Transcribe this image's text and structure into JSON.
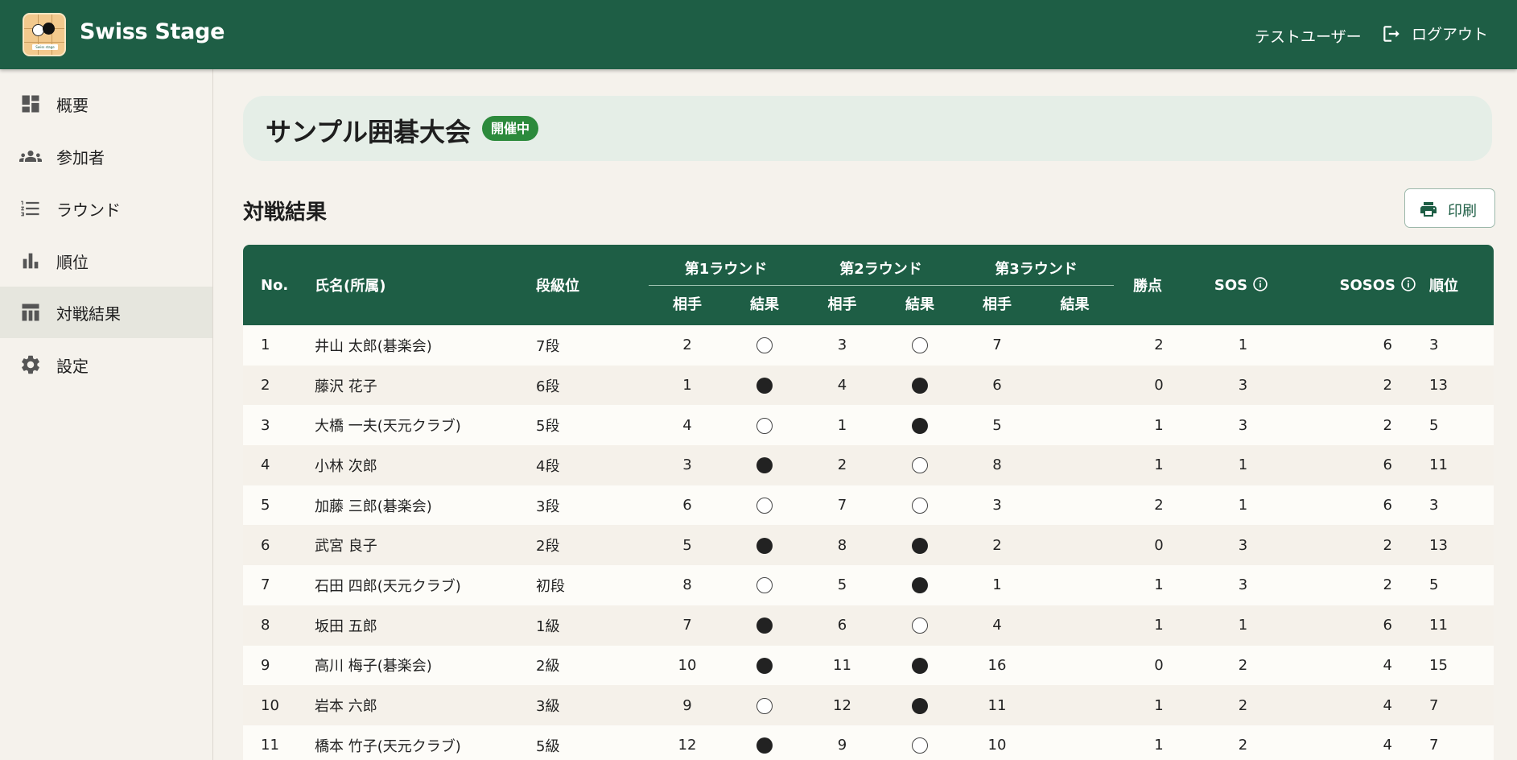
{
  "app": {
    "title": "Swiss Stage",
    "logo_text": "Swiss stage"
  },
  "header": {
    "user_name": "テストユーザー",
    "logout_label": "ログアウト"
  },
  "sidebar": {
    "items": [
      {
        "label": "概要",
        "icon": "dashboard-icon",
        "active": false
      },
      {
        "label": "参加者",
        "icon": "people-icon",
        "active": false
      },
      {
        "label": "ラウンド",
        "icon": "numbered-list-icon",
        "active": false
      },
      {
        "label": "順位",
        "icon": "bar-chart-icon",
        "active": false
      },
      {
        "label": "対戦結果",
        "icon": "table-icon",
        "active": true
      },
      {
        "label": "設定",
        "icon": "gear-icon",
        "active": false
      }
    ]
  },
  "tournament": {
    "name": "サンプル囲碁大会",
    "status": "開催中"
  },
  "section": {
    "title": "対戦結果",
    "print_label": "印刷"
  },
  "table": {
    "headers": {
      "no": "No.",
      "name": "氏名(所属)",
      "rank": "段級位",
      "rounds": [
        "第1ラウンド",
        "第2ラウンド",
        "第3ラウンド"
      ],
      "opponent": "相手",
      "result": "結果",
      "wins": "勝点",
      "sos": "SOS",
      "sosos": "SOSOS",
      "place": "順位"
    },
    "rows": [
      {
        "no": "1",
        "name": "井山 太郎(碁楽会)",
        "rank": "7段",
        "r1_opp": "2",
        "r1_res": "win",
        "r2_opp": "3",
        "r2_res": "win",
        "r3_opp": "7",
        "r3_res": "",
        "wins": "2",
        "sos": "1",
        "sosos": "6",
        "place": "3"
      },
      {
        "no": "2",
        "name": "藤沢 花子",
        "rank": "6段",
        "r1_opp": "1",
        "r1_res": "loss",
        "r2_opp": "4",
        "r2_res": "loss",
        "r3_opp": "6",
        "r3_res": "",
        "wins": "0",
        "sos": "3",
        "sosos": "2",
        "place": "13"
      },
      {
        "no": "3",
        "name": "大橋 一夫(天元クラブ)",
        "rank": "5段",
        "r1_opp": "4",
        "r1_res": "win",
        "r2_opp": "1",
        "r2_res": "loss",
        "r3_opp": "5",
        "r3_res": "",
        "wins": "1",
        "sos": "3",
        "sosos": "2",
        "place": "5"
      },
      {
        "no": "4",
        "name": "小林 次郎",
        "rank": "4段",
        "r1_opp": "3",
        "r1_res": "loss",
        "r2_opp": "2",
        "r2_res": "win",
        "r3_opp": "8",
        "r3_res": "",
        "wins": "1",
        "sos": "1",
        "sosos": "6",
        "place": "11"
      },
      {
        "no": "5",
        "name": "加藤 三郎(碁楽会)",
        "rank": "3段",
        "r1_opp": "6",
        "r1_res": "win",
        "r2_opp": "7",
        "r2_res": "win",
        "r3_opp": "3",
        "r3_res": "",
        "wins": "2",
        "sos": "1",
        "sosos": "6",
        "place": "3"
      },
      {
        "no": "6",
        "name": "武宮 良子",
        "rank": "2段",
        "r1_opp": "5",
        "r1_res": "loss",
        "r2_opp": "8",
        "r2_res": "loss",
        "r3_opp": "2",
        "r3_res": "",
        "wins": "0",
        "sos": "3",
        "sosos": "2",
        "place": "13"
      },
      {
        "no": "7",
        "name": "石田 四郎(天元クラブ)",
        "rank": "初段",
        "r1_opp": "8",
        "r1_res": "win",
        "r2_opp": "5",
        "r2_res": "loss",
        "r3_opp": "1",
        "r3_res": "",
        "wins": "1",
        "sos": "3",
        "sosos": "2",
        "place": "5"
      },
      {
        "no": "8",
        "name": "坂田 五郎",
        "rank": "1級",
        "r1_opp": "7",
        "r1_res": "loss",
        "r2_opp": "6",
        "r2_res": "win",
        "r3_opp": "4",
        "r3_res": "",
        "wins": "1",
        "sos": "1",
        "sosos": "6",
        "place": "11"
      },
      {
        "no": "9",
        "name": "高川 梅子(碁楽会)",
        "rank": "2級",
        "r1_opp": "10",
        "r1_res": "loss",
        "r2_opp": "11",
        "r2_res": "loss",
        "r3_opp": "16",
        "r3_res": "",
        "wins": "0",
        "sos": "2",
        "sosos": "4",
        "place": "15"
      },
      {
        "no": "10",
        "name": "岩本 六郎",
        "rank": "3級",
        "r1_opp": "9",
        "r1_res": "win",
        "r2_opp": "12",
        "r2_res": "loss",
        "r3_opp": "11",
        "r3_res": "",
        "wins": "1",
        "sos": "2",
        "sosos": "4",
        "place": "7"
      },
      {
        "no": "11",
        "name": "橋本 竹子(天元クラブ)",
        "rank": "5級",
        "r1_opp": "12",
        "r1_res": "loss",
        "r2_opp": "9",
        "r2_res": "win",
        "r3_opp": "10",
        "r3_res": "",
        "wins": "1",
        "sos": "2",
        "sosos": "4",
        "place": "7"
      }
    ]
  },
  "colors": {
    "primary": "#1e5e45",
    "badge": "#2c8a3c",
    "banner": "#e5eee7",
    "background": "#f5f2ec"
  }
}
